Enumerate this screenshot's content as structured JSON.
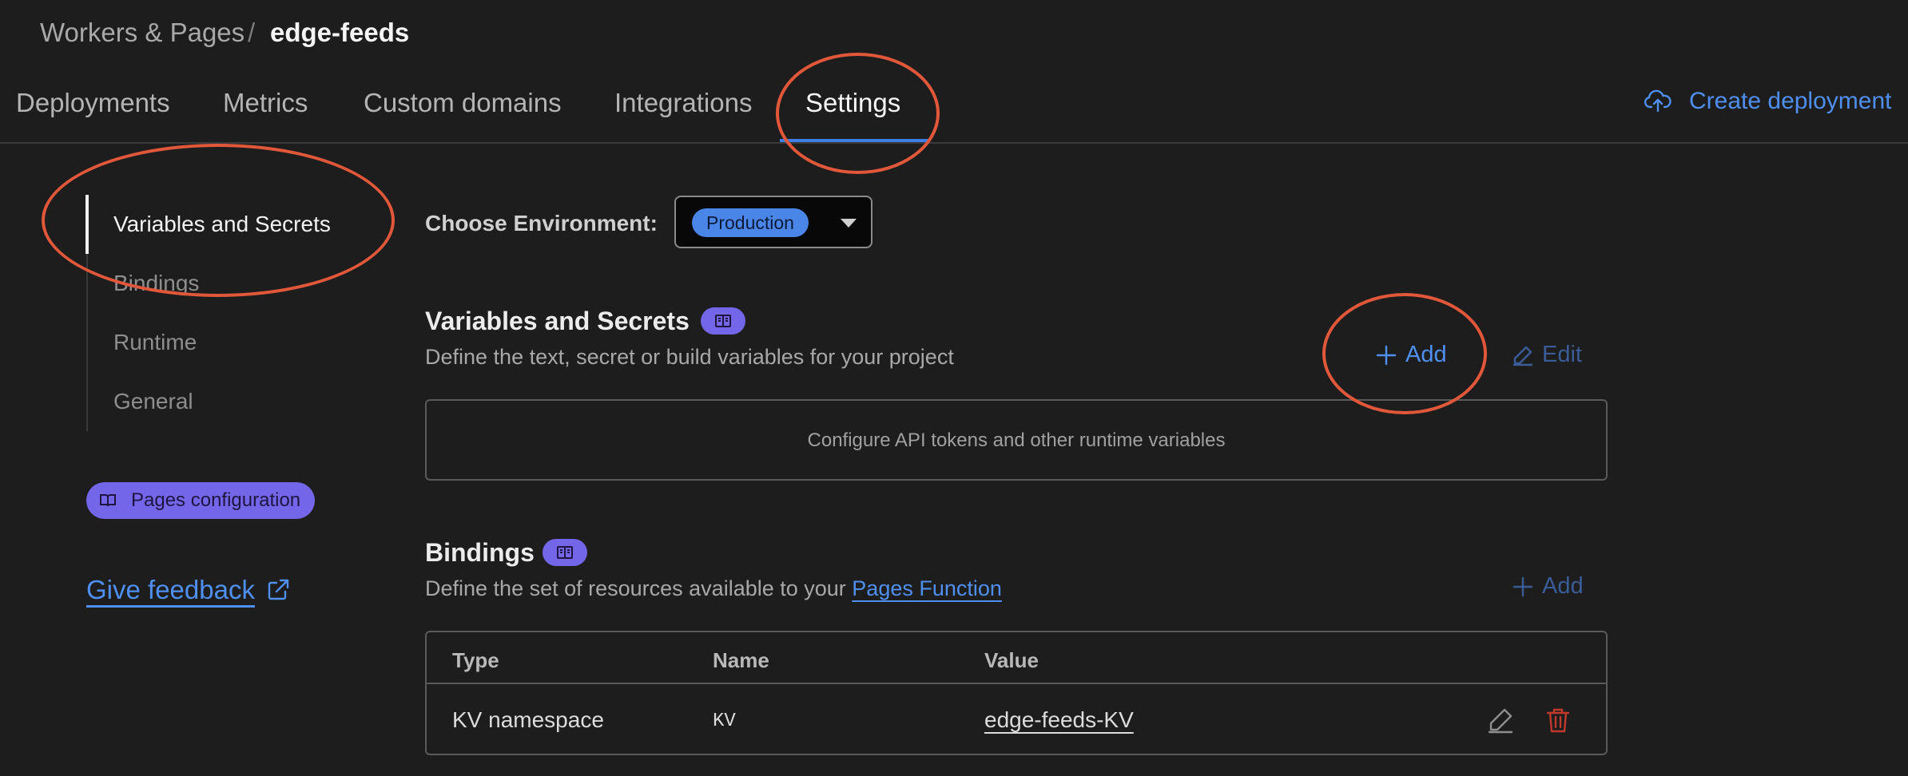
{
  "breadcrumb": {
    "parent": "Workers & Pages",
    "separator": "/",
    "current": "edge-feeds"
  },
  "tabs": [
    {
      "label": "Deployments",
      "active": false
    },
    {
      "label": "Metrics",
      "active": false
    },
    {
      "label": "Custom domains",
      "active": false
    },
    {
      "label": "Integrations",
      "active": false
    },
    {
      "label": "Settings",
      "active": true
    }
  ],
  "header_action": {
    "label": "Create deployment",
    "icon": "cloud-upload-icon"
  },
  "sidebar": {
    "items": [
      {
        "label": "Variables and Secrets",
        "active": true
      },
      {
        "label": "Bindings",
        "active": false
      },
      {
        "label": "Runtime",
        "active": false
      },
      {
        "label": "General",
        "active": false
      }
    ],
    "pages_config_label": "Pages configuration",
    "feedback_label": "Give feedback"
  },
  "environment": {
    "label": "Choose Environment:",
    "selected": "Production"
  },
  "variables_section": {
    "title": "Variables and Secrets",
    "description": "Define the text, secret or build variables for your project",
    "add_label": "Add",
    "edit_label": "Edit",
    "empty_text": "Configure API tokens and other runtime variables"
  },
  "bindings_section": {
    "title": "Bindings",
    "description_prefix": "Define the set of resources available to your ",
    "description_link": "Pages Function",
    "add_label": "Add",
    "table": {
      "columns": [
        "Type",
        "Name",
        "Value"
      ],
      "rows": [
        {
          "type": "KV namespace",
          "name": "KV",
          "value": "edge-feeds-KV"
        }
      ]
    }
  },
  "colors": {
    "background": "#1d1d1d",
    "accent": "#4f8ff0",
    "badge_purple": "#7366e8",
    "annotation": "#e0573a",
    "delete_red": "#c0392b"
  }
}
